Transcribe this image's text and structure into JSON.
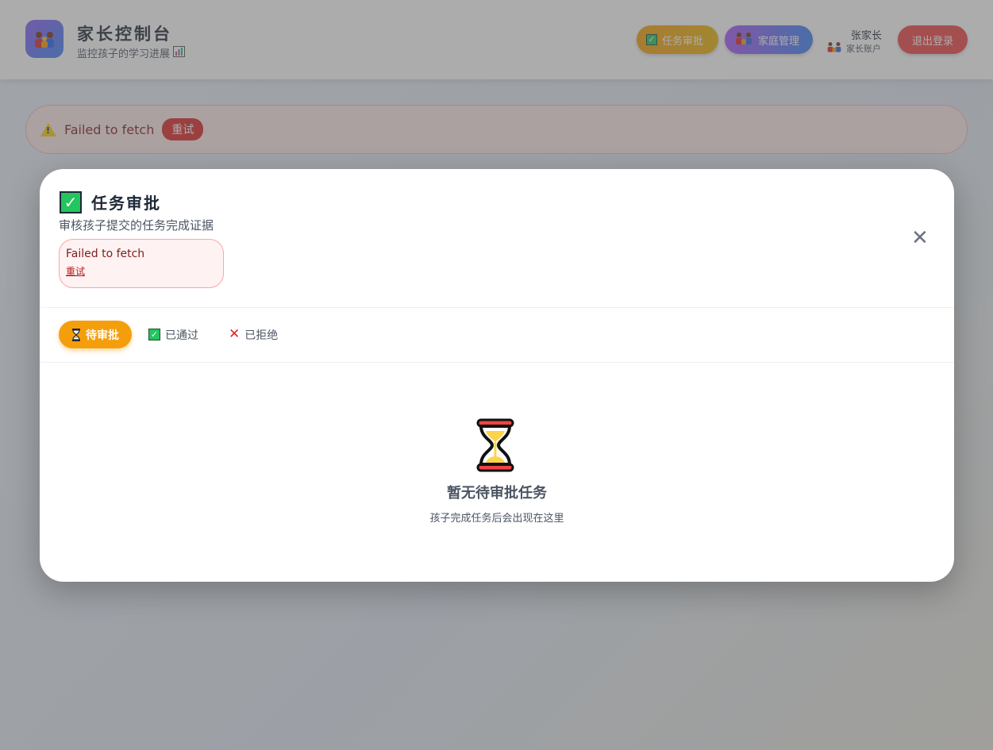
{
  "header": {
    "title": "家长控制台",
    "subtitle": "监控孩子的学习进展",
    "logo_icon": "family-icon",
    "nav": {
      "approve_label": "任务审批",
      "family_label": "家庭管理"
    },
    "user": {
      "name": "张家长",
      "role": "家长账户"
    },
    "logout_label": "退出登录"
  },
  "page_error": {
    "message": "Failed to fetch",
    "retry_label": "重试"
  },
  "modal": {
    "title": "任务审批",
    "subtitle": "审核孩子提交的任务完成证据",
    "error": {
      "message": "Failed to fetch",
      "retry_label": "重试"
    },
    "close_icon": "close-icon",
    "tabs": [
      {
        "label": "待审批",
        "icon": "hourglass-icon",
        "active": true
      },
      {
        "label": "已通过",
        "icon": "check-icon",
        "active": false
      },
      {
        "label": "已拒绝",
        "icon": "cross-icon",
        "active": false
      }
    ],
    "empty": {
      "icon": "hourglass-icon",
      "title": "暂无待审批任务",
      "description": "孩子完成任务后会出现在这里"
    }
  },
  "colors": {
    "accent_orange": "#f59e0b",
    "danger": "#ef4444",
    "success": "#22c55e"
  }
}
